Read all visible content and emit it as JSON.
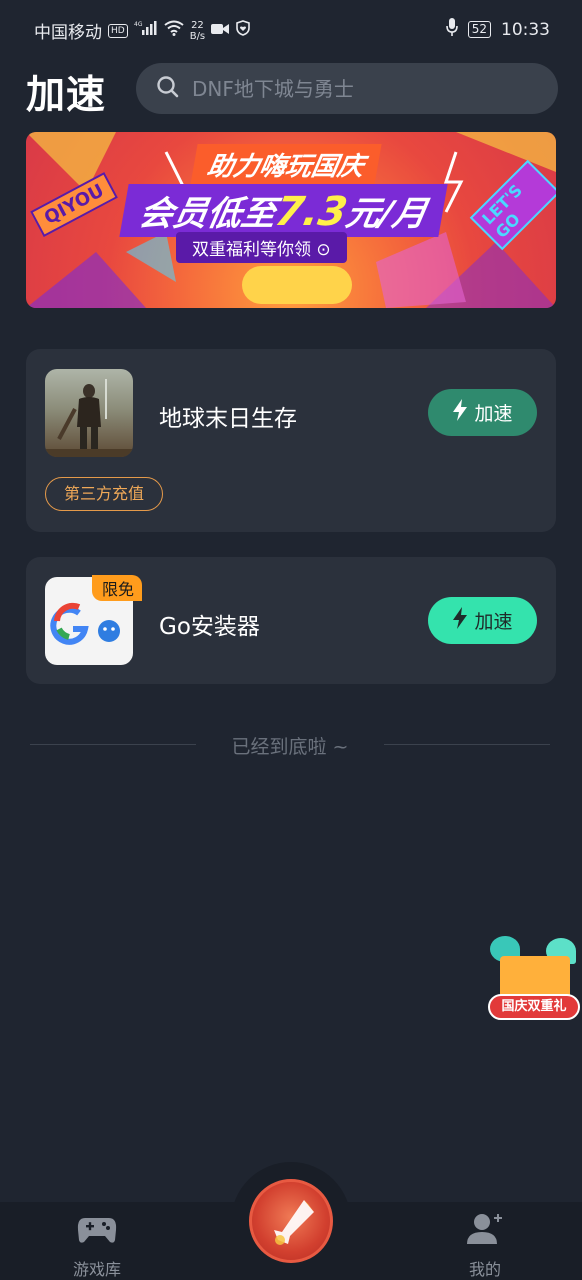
{
  "status_bar": {
    "carrier": "中国移动",
    "hd": "HD",
    "network_gen": "4G",
    "speed_value": "22",
    "speed_unit": "B/s",
    "battery": "52",
    "time": "10:33"
  },
  "header": {
    "title": "加速",
    "search_placeholder": "DNF地下城与勇士"
  },
  "banner": {
    "line1": "助力嗨玩国庆",
    "line2_prefix": "会员低至",
    "line2_price": "7.3",
    "line2_suffix": "元/月",
    "line3": "双重福利等你领 ⊙",
    "tag_left": "QIYOU",
    "tag_right": "LET'S GO"
  },
  "games": [
    {
      "name": "地球末日生存",
      "button_label": "加速",
      "tag": "第三方充值"
    },
    {
      "name": "Go安装器",
      "button_label": "加速",
      "badge": "限免"
    }
  ],
  "end_text": "已经到底啦 ~",
  "promo": {
    "label": "国庆双重礼"
  },
  "tab_bar": {
    "games_label": "游戏库",
    "mine_label": "我的"
  },
  "colors": {
    "background": "#1f2530",
    "card": "#2b313c",
    "accent_green": "#34e3ad",
    "accent_green_dim": "#2f8a6e",
    "tag_orange": "#f0a958"
  }
}
